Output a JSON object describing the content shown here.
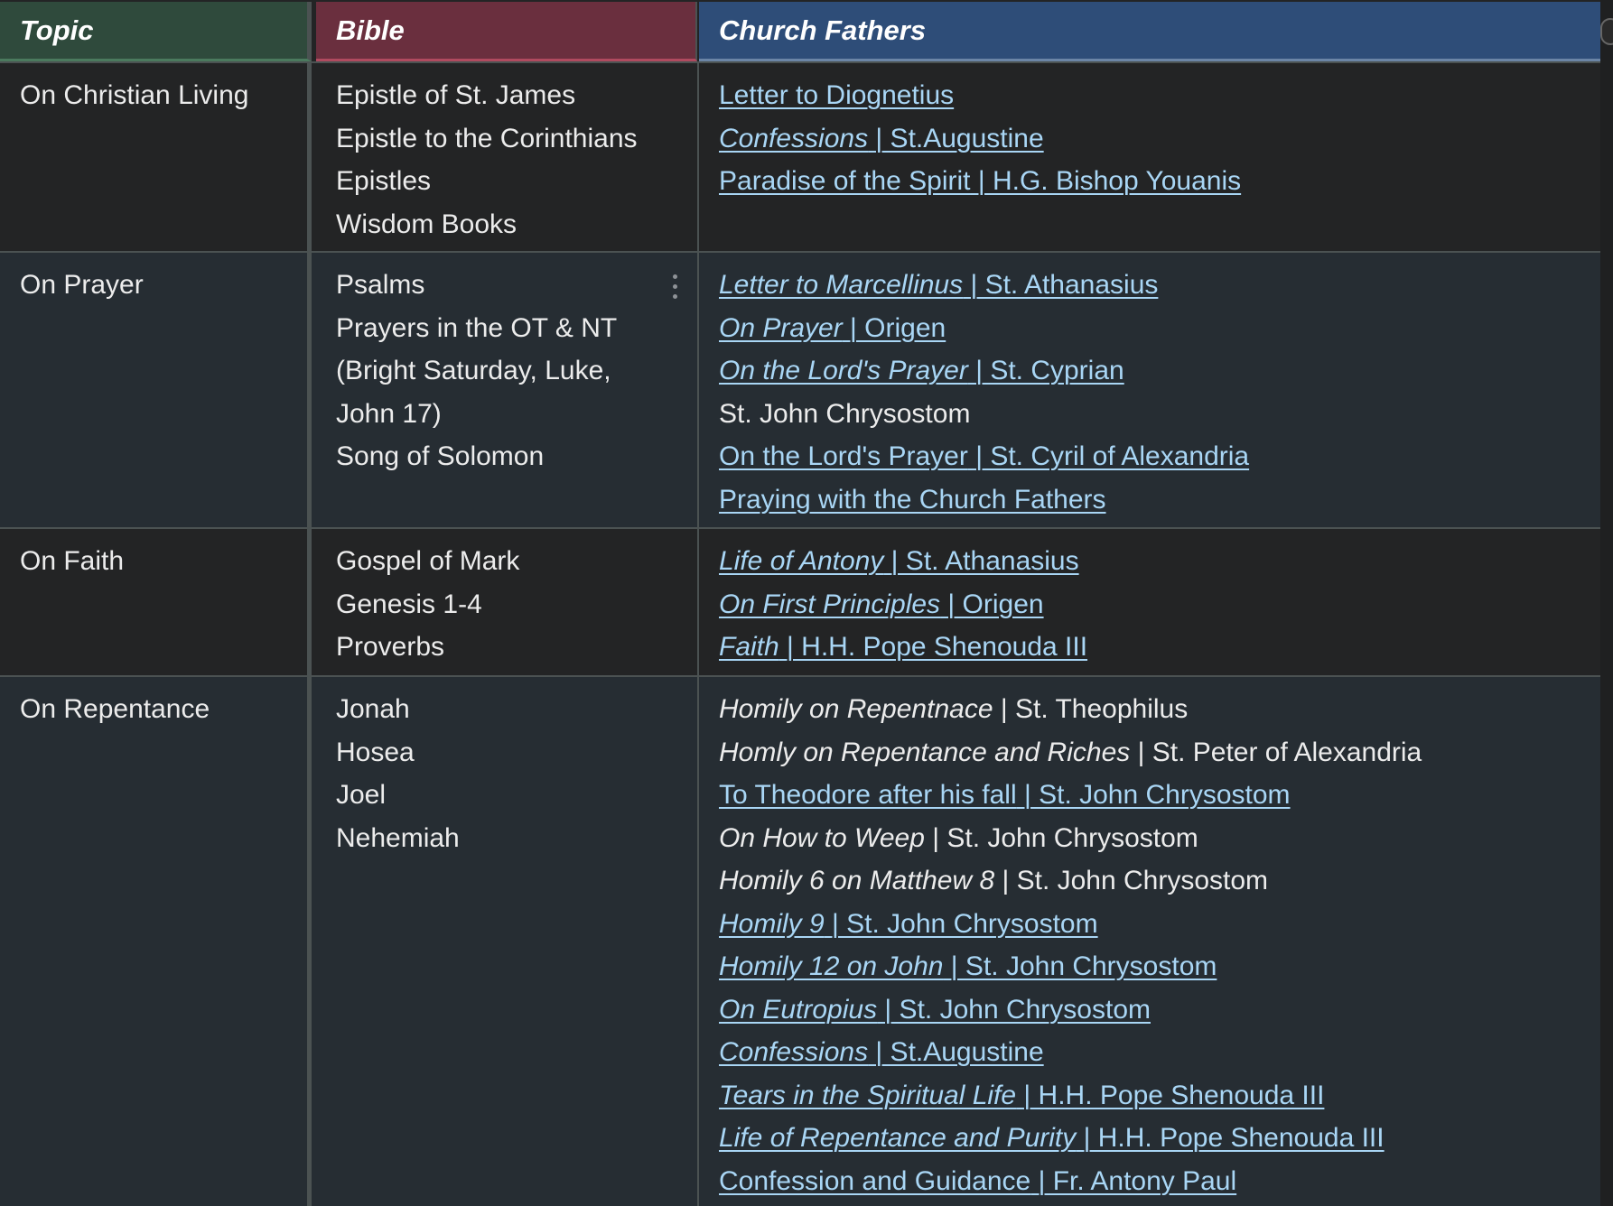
{
  "headers": {
    "topic": "Topic",
    "bible": "Bible",
    "fathers": "Church Fathers"
  },
  "rows": [
    {
      "topic": "On Christian Living",
      "bible": [
        "Epistle of St. James",
        "Epistle to the Corinthians",
        "Epistles",
        "Wisdom Books"
      ],
      "fathers": [
        {
          "title": "Letter to Diognetius",
          "author": "",
          "link": true,
          "italic_title": false
        },
        {
          "title": "Confessions",
          "author": " | St.Augustine",
          "link": true,
          "italic_title": true
        },
        {
          "title": "Paradise of the Spirit",
          "author": " | H.G. Bishop Youanis",
          "link": true,
          "italic_title": false
        }
      ]
    },
    {
      "topic": "On Prayer",
      "bible": [
        "Psalms",
        "Prayers in the OT & NT",
        "(Bright Saturday, Luke,",
        "John 17)",
        "Song of Solomon"
      ],
      "fathers": [
        {
          "title": "Letter to Marcellinus",
          "author": " | St. Athanasius",
          "link": true,
          "italic_title": true
        },
        {
          "title": "On Prayer",
          "author": " | Origen",
          "link": true,
          "italic_title": true
        },
        {
          "title": "On the Lord's Prayer",
          "author": " | St. Cyprian",
          "link": true,
          "italic_title": true
        },
        {
          "title": "St. John Chrysostom",
          "author": "",
          "link": false,
          "italic_title": false
        },
        {
          "title": "On the Lord's Prayer",
          "author": " | St. Cyril of Alexandria",
          "link": true,
          "italic_title": false
        },
        {
          "title": "Praying with the Church Fathers",
          "author": "",
          "link": true,
          "italic_title": false
        }
      ]
    },
    {
      "topic": "On Faith",
      "bible": [
        "Gospel of Mark",
        "Genesis 1-4",
        "Proverbs"
      ],
      "fathers": [
        {
          "title": "Life of Antony",
          "author": " | St. Athanasius",
          "link": true,
          "italic_title": true
        },
        {
          "title": "On First Principles",
          "author": " | Origen",
          "link": true,
          "italic_title": true
        },
        {
          "title": "Faith",
          "author": " | H.H. Pope Shenouda III",
          "link": true,
          "italic_title": true
        }
      ]
    },
    {
      "topic": "On Repentance",
      "bible": [
        "Jonah",
        "Hosea",
        "Joel",
        "Nehemiah"
      ],
      "fathers": [
        {
          "title": "Homily on Repentnace",
          "author": " | St. Theophilus",
          "link": false,
          "italic_title": true
        },
        {
          "title": "Homly on Repentance and Riches",
          "author": " | St. Peter of Alexandria",
          "link": false,
          "italic_title": true
        },
        {
          "title": "To Theodore after his fall",
          "author": " | St. John Chrysostom",
          "link": true,
          "italic_title": false
        },
        {
          "title": "On How to Weep",
          "author": " | St. John Chrysostom",
          "link": false,
          "italic_title": true
        },
        {
          "title": "Homily 6 on Matthew 8",
          "author": " | St. John Chrysostom",
          "link": false,
          "italic_title": true
        },
        {
          "title": "Homily 9",
          "author": " | St. John Chrysostom",
          "link": true,
          "italic_title": true
        },
        {
          "title": "Homily 12 on John",
          "author": " | St. John Chrysostom",
          "link": true,
          "italic_title": true
        },
        {
          "title": "On Eutropius",
          "author": " | St. John Chrysostom",
          "link": true,
          "italic_title": true
        },
        {
          "title": "Confessions",
          "author": " | St.Augustine",
          "link": true,
          "italic_title": true
        },
        {
          "title": "Tears in the Spiritual Life",
          "author": " | H.H. Pope Shenouda III",
          "link": true,
          "italic_title": true
        },
        {
          "title": "Life of Repentance and Purity",
          "author": " | H.H. Pope Shenouda III",
          "link": true,
          "italic_title": true
        },
        {
          "title": "Confession and Guidance",
          "author": " | Fr. Antony Paul",
          "link": true,
          "italic_title": false
        }
      ]
    }
  ],
  "colors": {
    "topic_header": "#2f4a3c",
    "bible_header": "#6a2f3e",
    "fathers_header": "#2e4d78",
    "link": "#a9d6f5",
    "text": "#ececec"
  },
  "icons": {
    "row_menu": "kebab-menu-icon"
  }
}
